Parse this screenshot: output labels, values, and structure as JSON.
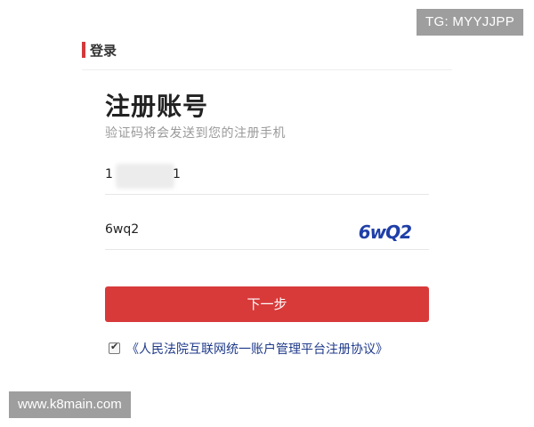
{
  "watermarks": {
    "top_right": "TG: MYYJJPP",
    "bottom_left": "www.k8main.com"
  },
  "header": {
    "login_label": "登录"
  },
  "form": {
    "title": "注册账号",
    "subtitle": "验证码将会发送到您的注册手机",
    "phone": {
      "prefix": "1",
      "suffix": "1"
    },
    "captcha": {
      "value": "6wq2",
      "image_text": "6wQ2"
    },
    "next_button": "下一步",
    "agreement": {
      "checked": true,
      "checkmark": "✔",
      "text": "《人民法院互联网统一账户管理平台注册协议》"
    }
  },
  "colors": {
    "accent": "#d83a3a",
    "link": "#1f3a8a",
    "captcha": "#1f3fa8"
  }
}
